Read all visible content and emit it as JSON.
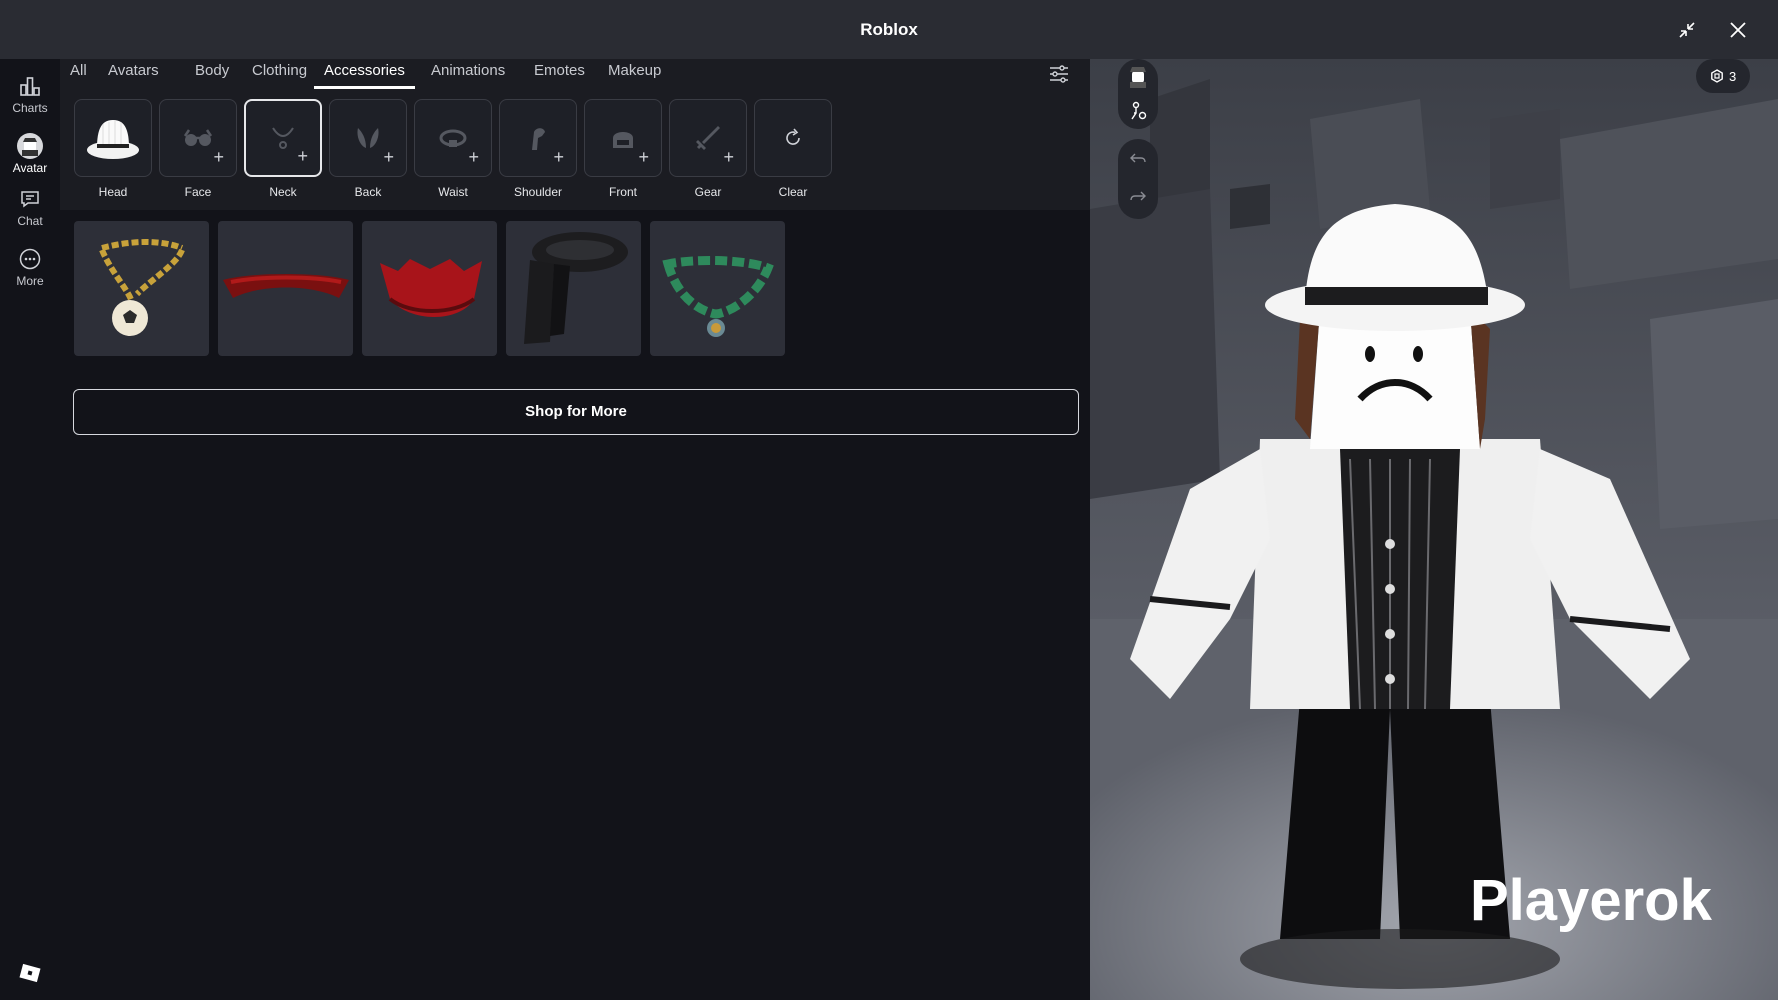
{
  "window": {
    "title": "Roblox"
  },
  "rail": {
    "items": [
      {
        "label": "Charts",
        "icon": "charts-icon"
      },
      {
        "label": "Avatar",
        "icon": "avatar-icon"
      },
      {
        "label": "Chat",
        "icon": "chat-icon"
      },
      {
        "label": "More",
        "icon": "more-icon"
      }
    ],
    "active": "Avatar"
  },
  "tabs": [
    "All",
    "Avatars",
    "Body",
    "Clothing",
    "Accessories",
    "Animations",
    "Emotes",
    "Makeup"
  ],
  "active_tab": "Accessories",
  "slots": [
    {
      "label": "Head",
      "icon": "fedora-hat",
      "filled": true
    },
    {
      "label": "Face",
      "icon": "glasses-icon",
      "filled": false
    },
    {
      "label": "Neck",
      "icon": "necklace-icon",
      "filled": false,
      "selected": true
    },
    {
      "label": "Back",
      "icon": "wings-icon",
      "filled": false
    },
    {
      "label": "Waist",
      "icon": "belt-icon",
      "filled": false
    },
    {
      "label": "Shoulder",
      "icon": "parrot-icon",
      "filled": false
    },
    {
      "label": "Front",
      "icon": "bag-icon",
      "filled": false
    },
    {
      "label": "Gear",
      "icon": "sword-icon",
      "filled": false
    },
    {
      "label": "Clear",
      "icon": "refresh-icon",
      "filled": false
    }
  ],
  "items": [
    {
      "name": "gold-chain-soccer-ball-necklace"
    },
    {
      "name": "red-collar"
    },
    {
      "name": "red-spiked-collar"
    },
    {
      "name": "black-scarf"
    },
    {
      "name": "green-bead-necklace"
    }
  ],
  "shop_button": "Shop for More",
  "viewport": {
    "robux_count": "3",
    "player_name": "Playerok"
  }
}
